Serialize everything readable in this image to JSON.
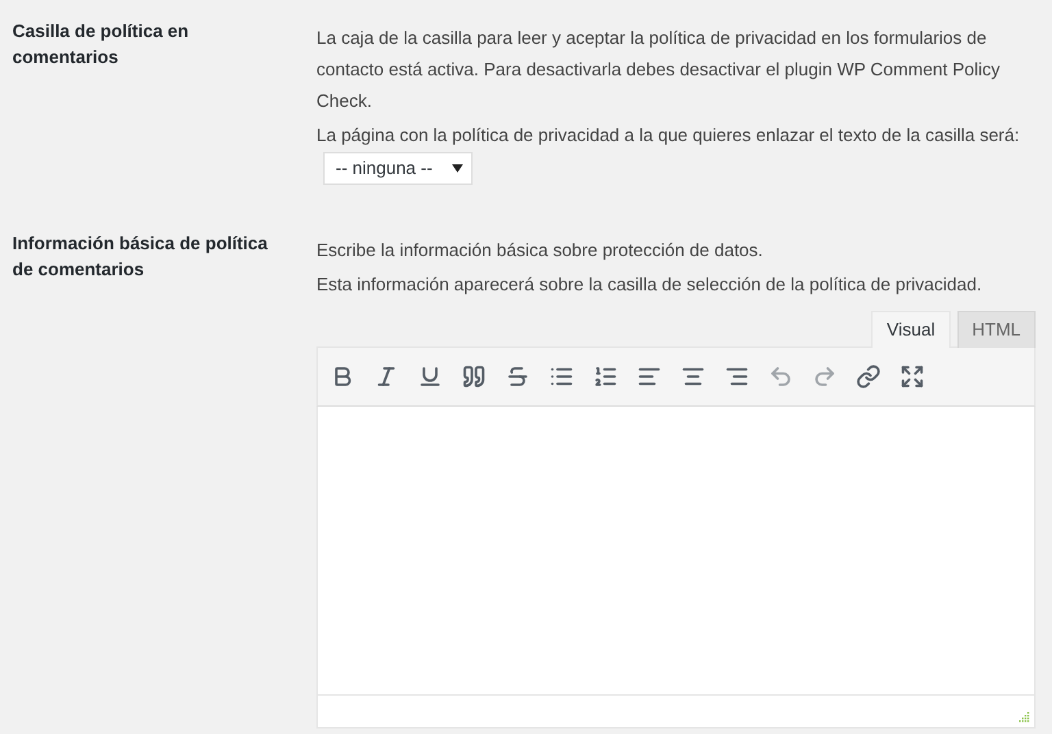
{
  "sections": [
    {
      "label": "Casilla de política en comentarios",
      "paragraphs": [
        "La caja de la casilla para leer y aceptar la política de privacidad en los formularios de contacto está activa. Para desactivarla debes desactivar el plugin WP Comment Policy Check."
      ],
      "select_prefix": "La página con la política de privacidad a la que quieres enlazar el texto de la casilla será:",
      "select": {
        "value": "-- ninguna --"
      }
    },
    {
      "label": "Información básica de política de comentarios",
      "paragraphs": [
        "Escribe la información básica sobre protección de datos.",
        "Esta información aparecerá sobre la casilla de selección de la política de privacidad."
      ],
      "editor": {
        "tabs": [
          {
            "label": "Visual",
            "selected": true
          },
          {
            "label": "HTML",
            "selected": false
          }
        ],
        "toolbar": [
          {
            "kind": "bold",
            "disabled": false
          },
          {
            "kind": "italic",
            "disabled": false
          },
          {
            "kind": "underline",
            "disabled": false
          },
          {
            "kind": "quote",
            "disabled": false
          },
          {
            "kind": "strike",
            "disabled": false
          },
          {
            "kind": "bullets",
            "disabled": false
          },
          {
            "kind": "numbers",
            "disabled": false
          },
          {
            "kind": "align-left",
            "disabled": false
          },
          {
            "kind": "align-center",
            "disabled": false
          },
          {
            "kind": "align-right",
            "disabled": false
          },
          {
            "kind": "undo",
            "disabled": true
          },
          {
            "kind": "redo",
            "disabled": true
          },
          {
            "kind": "link",
            "disabled": false
          },
          {
            "kind": "fullscreen",
            "disabled": false
          }
        ]
      }
    }
  ]
}
